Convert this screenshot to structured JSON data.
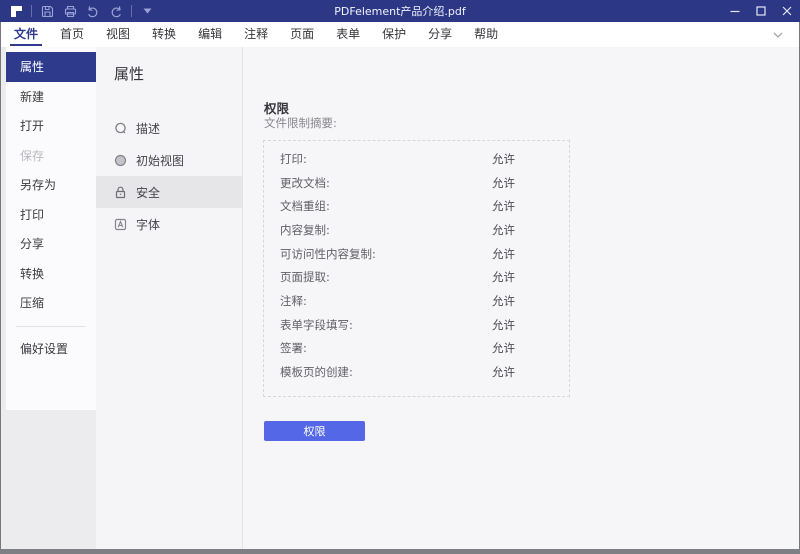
{
  "colors": {
    "titlebar_bg": "#2c3886",
    "accent": "#2e3a8c",
    "button_blue": "#5468e7",
    "selected_tab_bg": "#e6e6e9"
  },
  "titlebar": {
    "title": "PDFelement产品介绍.pdf",
    "quick_access_icons": [
      "pdfelement-logo",
      "save",
      "print",
      "undo",
      "redo",
      "customize-dropdown"
    ],
    "window_controls": [
      "minimize",
      "maximize",
      "close"
    ]
  },
  "menubar": {
    "active_item": "文件",
    "items": [
      {
        "id": "file",
        "label": "文件"
      },
      {
        "id": "home",
        "label": "首页"
      },
      {
        "id": "view",
        "label": "视图"
      },
      {
        "id": "convert",
        "label": "转换"
      },
      {
        "id": "edit",
        "label": "编辑"
      },
      {
        "id": "comment",
        "label": "注释"
      },
      {
        "id": "page",
        "label": "页面"
      },
      {
        "id": "form",
        "label": "表单"
      },
      {
        "id": "protect",
        "label": "保护"
      },
      {
        "id": "share",
        "label": "分享"
      },
      {
        "id": "help",
        "label": "帮助"
      }
    ]
  },
  "file_menu": {
    "items": [
      {
        "id": "properties",
        "label": "属性",
        "state": "active"
      },
      {
        "id": "new",
        "label": "新建",
        "state": "normal"
      },
      {
        "id": "open",
        "label": "打开",
        "state": "normal"
      },
      {
        "id": "save",
        "label": "保存",
        "state": "disabled"
      },
      {
        "id": "save-as",
        "label": "另存为",
        "state": "normal"
      },
      {
        "id": "print",
        "label": "打印",
        "state": "normal"
      },
      {
        "id": "share",
        "label": "分享",
        "state": "normal"
      },
      {
        "id": "convert",
        "label": "转换",
        "state": "normal"
      },
      {
        "id": "compress",
        "label": "压缩",
        "state": "normal"
      }
    ],
    "footer_item": {
      "id": "preferences",
      "label": "偏好设置"
    }
  },
  "properties_panel": {
    "title": "属性",
    "tabs": [
      {
        "id": "description",
        "label": "描述",
        "icon": "description-circle-icon",
        "state": "normal"
      },
      {
        "id": "initial-view",
        "label": "初始视图",
        "icon": "initial-view-circle-icon",
        "state": "normal"
      },
      {
        "id": "security",
        "label": "安全",
        "icon": "lock-icon",
        "state": "selected"
      },
      {
        "id": "fonts",
        "label": "字体",
        "icon": "font-a-icon",
        "state": "normal"
      }
    ]
  },
  "permissions": {
    "heading": "权限",
    "subheading": "文件限制摘要:",
    "rows": [
      {
        "label": "打印:",
        "value": "允许"
      },
      {
        "label": "更改文档:",
        "value": "允许"
      },
      {
        "label": "文档重组:",
        "value": "允许"
      },
      {
        "label": "内容复制:",
        "value": "允许"
      },
      {
        "label": "可访问性内容复制:",
        "value": "允许"
      },
      {
        "label": "页面提取:",
        "value": "允许"
      },
      {
        "label": "注释:",
        "value": "允许"
      },
      {
        "label": "表单字段填写:",
        "value": "允许"
      },
      {
        "label": "签署:",
        "value": "允许"
      },
      {
        "label": "模板页的创建:",
        "value": "允许"
      }
    ],
    "button_label": "权限"
  }
}
